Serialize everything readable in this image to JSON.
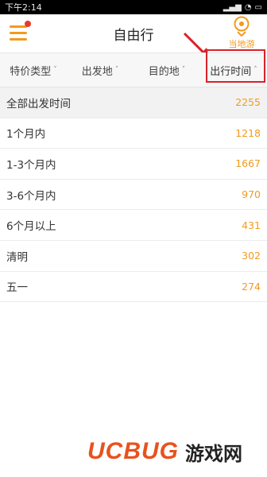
{
  "status_bar": {
    "time": "下午2:14"
  },
  "header": {
    "title": "自由行",
    "local_tour_label": "当地游"
  },
  "filters": [
    {
      "label": "特价类型"
    },
    {
      "label": "出发地"
    },
    {
      "label": "目的地"
    },
    {
      "label": "出行时间"
    }
  ],
  "list": [
    {
      "label": "全部出发时间",
      "count": "2255"
    },
    {
      "label": "1个月内",
      "count": "1218"
    },
    {
      "label": "1-3个月内",
      "count": "1667"
    },
    {
      "label": "3-6个月内",
      "count": "970"
    },
    {
      "label": "6个月以上",
      "count": "431"
    },
    {
      "label": "清明",
      "count": "302"
    },
    {
      "label": "五一",
      "count": "274"
    }
  ],
  "watermark": {
    "logo": "UCBUG",
    "text": "游戏网"
  },
  "colors": {
    "accent": "#f39a1c",
    "highlight": "#d8222a",
    "notify": "#e8382b"
  }
}
